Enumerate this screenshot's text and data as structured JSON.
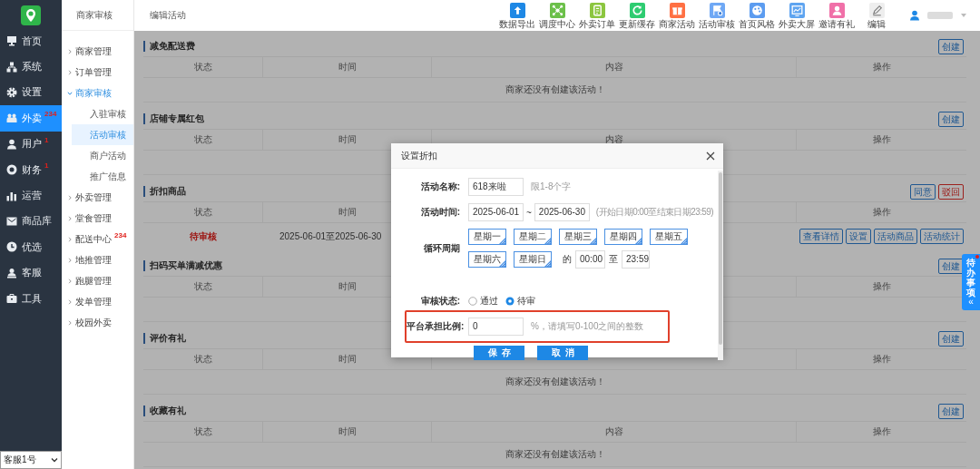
{
  "sidebar": {
    "items": [
      {
        "label": "首页",
        "selected": false
      },
      {
        "label": "系统",
        "selected": false
      },
      {
        "label": "设置",
        "selected": false
      },
      {
        "label": "外卖",
        "selected": true,
        "badge": "234"
      },
      {
        "label": "用户",
        "selected": false,
        "badge": "1"
      },
      {
        "label": "财务",
        "selected": false,
        "badge": "1"
      },
      {
        "label": "运营",
        "selected": false
      },
      {
        "label": "商品库",
        "selected": false
      },
      {
        "label": "优选",
        "selected": false
      },
      {
        "label": "客服",
        "selected": false
      },
      {
        "label": "工具",
        "selected": false
      }
    ],
    "account_select": {
      "value": "客服1号"
    }
  },
  "subnav": {
    "title": "商家审核",
    "items": [
      {
        "label": "商家管理",
        "expanded": false
      },
      {
        "label": "订单管理",
        "expanded": false
      },
      {
        "label": "商家审核",
        "expanded": true,
        "children": [
          {
            "label": "入驻审核",
            "selected": false
          },
          {
            "label": "活动审核",
            "selected": true
          },
          {
            "label": "商户活动",
            "selected": false
          },
          {
            "label": "推广信息",
            "selected": false
          }
        ]
      },
      {
        "label": "外卖管理",
        "expanded": false
      },
      {
        "label": "堂食管理",
        "expanded": false
      },
      {
        "label": "配送中心",
        "expanded": false,
        "badge": "234"
      },
      {
        "label": "地推管理",
        "expanded": false
      },
      {
        "label": "跑腿管理",
        "expanded": false
      },
      {
        "label": "发单管理",
        "expanded": false
      },
      {
        "label": "校园外卖",
        "expanded": false
      }
    ]
  },
  "topbar": {
    "breadcrumb": "编辑活动",
    "tools": [
      {
        "label": "数据导出",
        "color": "#1e88e5"
      },
      {
        "label": "调度中心",
        "color": "#6cc04a"
      },
      {
        "label": "外卖订单",
        "color": "#8cc63f"
      },
      {
        "label": "更新缓存",
        "color": "#2ecc71"
      },
      {
        "label": "商家活动",
        "color": "#ff7043"
      },
      {
        "label": "活动审核",
        "color": "#6fa8f5"
      },
      {
        "label": "首页风格",
        "color": "#5c9cf0"
      },
      {
        "label": "外卖大屏",
        "color": "#5ea4f0"
      },
      {
        "label": "邀请有礼",
        "color": "#f070a8"
      },
      {
        "label": "编辑",
        "color": "#eeeeee"
      }
    ]
  },
  "sections": [
    {
      "title": "减免配送费",
      "columns": {
        "status": "状态",
        "time": "时间",
        "content": "内容",
        "action": "操作"
      },
      "buttons": [
        {
          "label": "创建",
          "kind": "primary"
        }
      ],
      "empty_message": "商家还没有创建该活动！"
    },
    {
      "title": "店铺专属红包",
      "columns": {
        "status": "状态",
        "time": "时间",
        "content": "内容",
        "action": "操作"
      },
      "buttons": [
        {
          "label": "创建",
          "kind": "primary"
        }
      ]
    },
    {
      "title": "折扣商品",
      "columns": {
        "status": "状态",
        "time": "时间",
        "action": "操作"
      },
      "buttons": [
        {
          "label": "同意",
          "kind": "primary"
        },
        {
          "label": "驳回",
          "kind": "danger"
        }
      ],
      "rows": [
        {
          "status": "待审核",
          "time": "2025-06-01至2025-06-30",
          "actions": [
            "查看详情",
            "设置",
            "活动商品",
            "活动统计"
          ]
        }
      ]
    },
    {
      "title": "扫码买单满减优惠",
      "columns": {
        "status": "状态",
        "time": "时间",
        "action": "操作"
      },
      "buttons": [
        {
          "label": "创建",
          "kind": "primary"
        }
      ]
    },
    {
      "title": "评价有礼",
      "columns": {
        "status": "状态",
        "time": "时间",
        "action": "操作"
      },
      "buttons": [
        {
          "label": "创建",
          "kind": "primary"
        }
      ],
      "empty_message": "商家还没有创建该活动！"
    },
    {
      "title": "收藏有礼",
      "columns": {
        "status": "状态",
        "time": "时间",
        "content": "内容",
        "action": "操作"
      },
      "buttons": [
        {
          "label": "创建",
          "kind": "primary"
        }
      ],
      "empty_message": "商家还没有创建该活动！"
    }
  ],
  "modal": {
    "title": "设置折扣",
    "name": {
      "label": "活动名称:",
      "value": "618来啦",
      "hint": "限1-8个字"
    },
    "period": {
      "label": "活动时间:",
      "start": "2025-06-01",
      "separator": "~",
      "end": "2025-06-30",
      "hint": "(开始日期0:00至结束日期23:59)"
    },
    "cycle": {
      "label": "循环周期",
      "days": [
        {
          "label": "星期一",
          "selected": true
        },
        {
          "label": "星期二",
          "selected": true
        },
        {
          "label": "星期三",
          "selected": true
        },
        {
          "label": "星期四",
          "selected": true
        },
        {
          "label": "星期五",
          "selected": true
        },
        {
          "label": "星期六",
          "selected": true
        },
        {
          "label": "星期日",
          "selected": true
        }
      ],
      "from_label": "的",
      "start": "00:00",
      "to_label": "至",
      "end": "23:59"
    },
    "review": {
      "label": "审核状态:",
      "options": [
        {
          "label": "通过",
          "selected": false
        },
        {
          "label": "待审",
          "selected": true
        }
      ]
    },
    "ratio": {
      "label": "平台承担比例:",
      "value": "0",
      "hint": "%，请填写0-100之间的整数",
      "highlighted": true
    },
    "buttons": [
      {
        "label": "保存"
      },
      {
        "label": "取消"
      }
    ]
  },
  "todo": {
    "label": "待办事项",
    "collapse": "«"
  }
}
